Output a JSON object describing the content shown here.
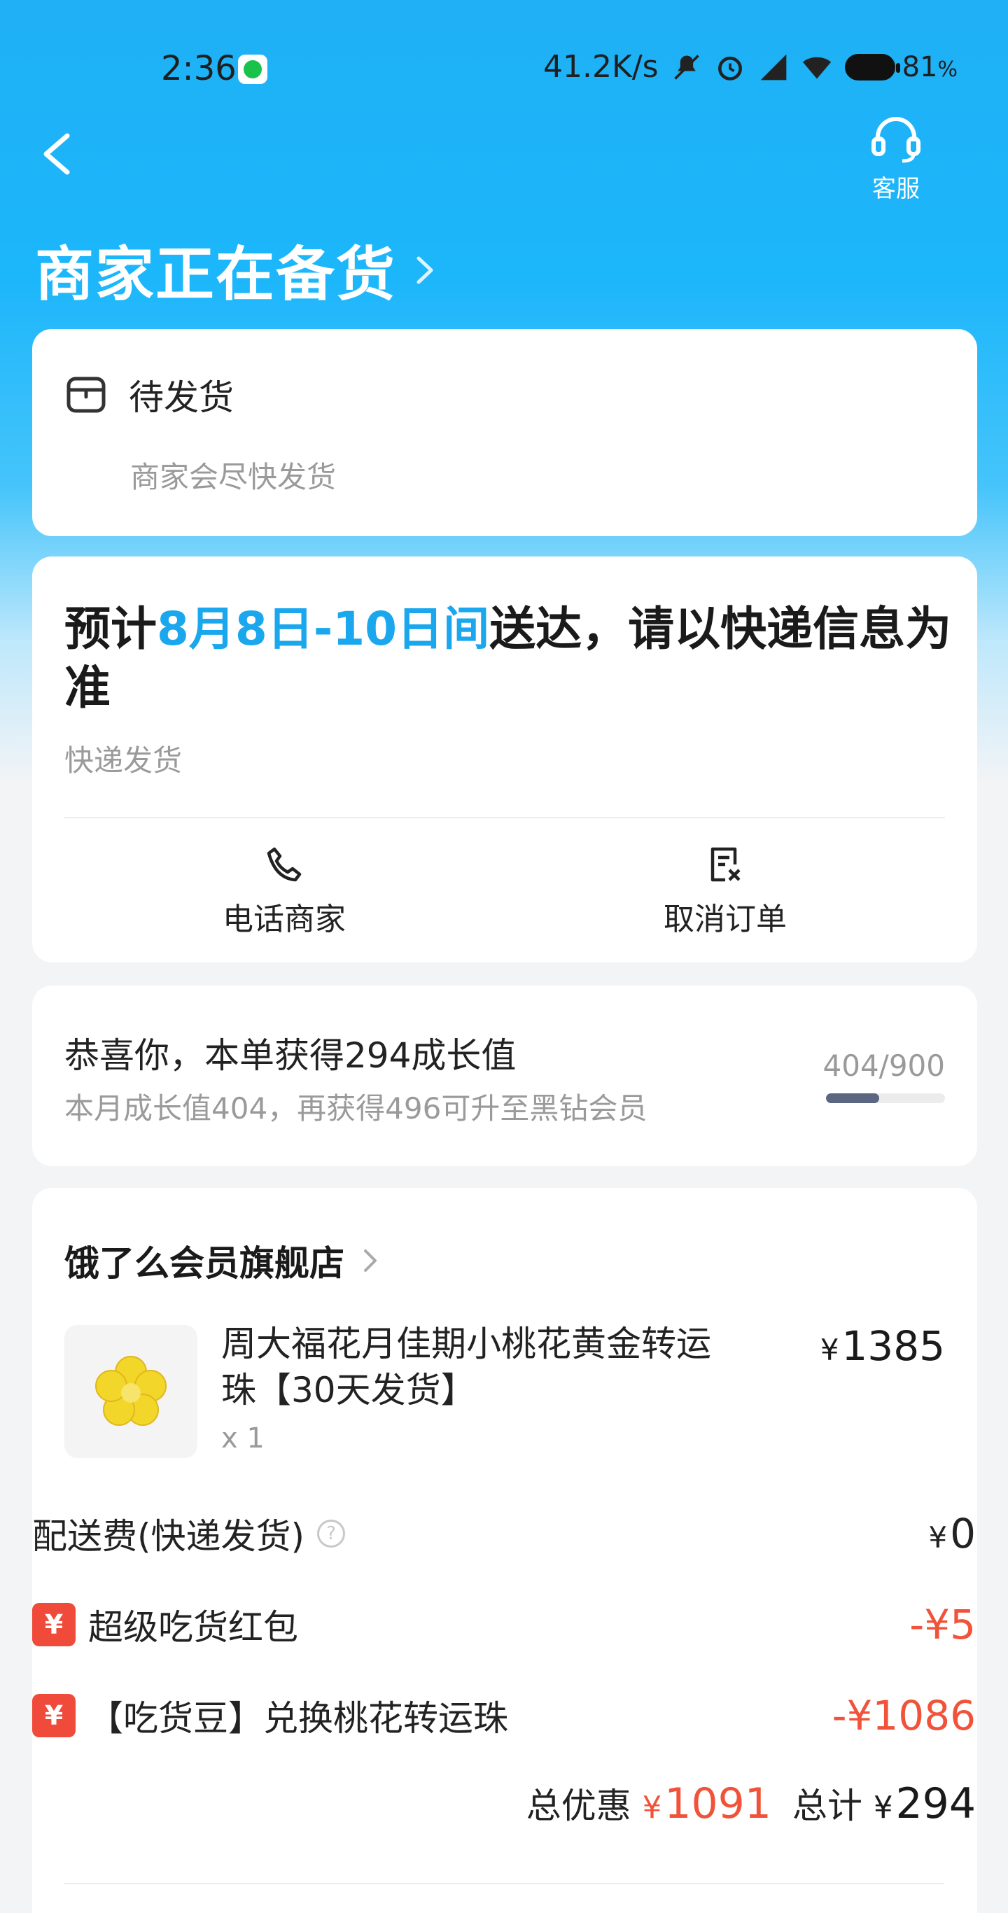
{
  "status_bar": {
    "time": "2:36",
    "net_speed": "41.2K/s",
    "battery": "81",
    "battery_unit": "%"
  },
  "header": {
    "service_label": "客服",
    "title": "商家正在备货"
  },
  "status_card": {
    "label": "待发货",
    "sub": "商家会尽快发货"
  },
  "delivery_card": {
    "prefix": "预计",
    "date_range": "8月8日-10日间",
    "suffix": "送达，请以快递信息为准",
    "method": "快递发货",
    "actions": [
      {
        "label": "电话商家",
        "icon": "phone-icon"
      },
      {
        "label": "取消订单",
        "icon": "cancel-order-icon"
      }
    ]
  },
  "growth_card": {
    "title": "恭喜你，本单获得294成长值",
    "sub": "本月成长值404，再获得496可升至黑钻会员",
    "ratio": "404/900",
    "progress": 0.449
  },
  "order_card": {
    "store": "饿了么会员旗舰店",
    "product": {
      "name": "周大福花月佳期小桃花黄金转运珠【30天发货】",
      "qty": "x 1",
      "currency": "¥",
      "price": "1385"
    },
    "shipping": {
      "label": "配送费(快递发货)",
      "currency": "¥",
      "amount": "0",
      "help": "?"
    },
    "discounts": [
      {
        "badge": "¥",
        "label": "超级吃货红包",
        "amount": "-¥5"
      },
      {
        "badge": "¥",
        "label": "【吃货豆】兑换桃花转运珠",
        "amount": "-¥1086"
      }
    ],
    "totals": {
      "discount_label": "总优惠",
      "discount_currency": "¥",
      "discount": "1091",
      "total_label": "总计",
      "total_currency": "¥",
      "total": "294"
    }
  },
  "colors": {
    "brand_blue": "#1aa7ee",
    "discount_red": "#f0533a"
  }
}
